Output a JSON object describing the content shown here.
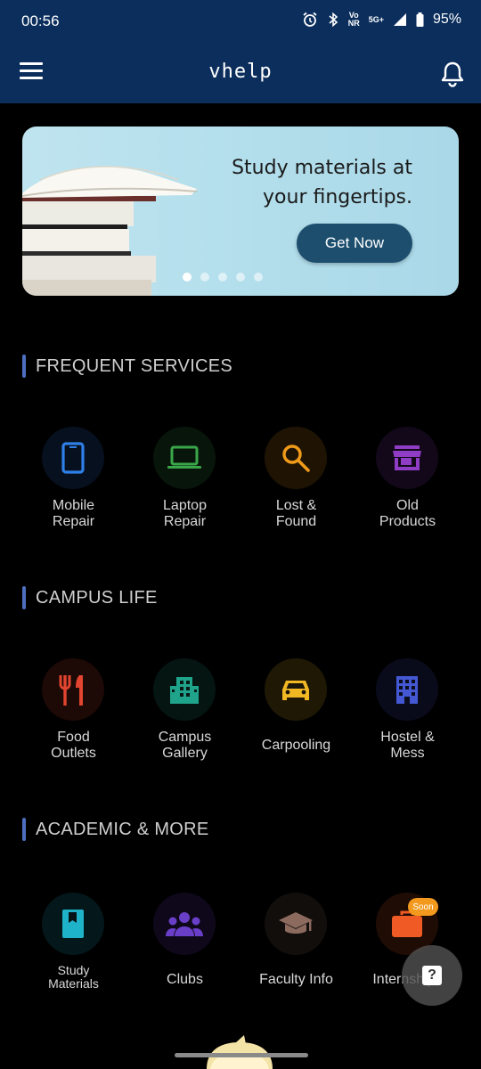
{
  "status_bar": {
    "time": "00:56",
    "network_top": "Vo",
    "network_bottom": "NR",
    "generation": "5G+",
    "battery": "95%"
  },
  "app_bar": {
    "title": "vhelp",
    "menu_icon": "hamburger-menu-icon",
    "notification_icon": "bell-icon"
  },
  "banner": {
    "text_line1": "Study materials at",
    "text_line2": "your fingertips.",
    "button_label": "Get Now",
    "slide_count": 5,
    "active_slide": 1
  },
  "sections": {
    "frequent": {
      "title": "FREQUENT SERVICES",
      "items": [
        {
          "line1": "Mobile",
          "line2": "Repair",
          "icon": "smartphone-icon",
          "color": "#2f7fe8"
        },
        {
          "line1": "Laptop",
          "line2": "Repair",
          "icon": "laptop-icon",
          "color": "#3aa64a"
        },
        {
          "line1": "Lost &",
          "line2": "Found",
          "icon": "search-icon",
          "color": "#f09a1a"
        },
        {
          "line1": "Old",
          "line2": "Products",
          "icon": "store-icon",
          "color": "#8e3dc4"
        }
      ]
    },
    "campus": {
      "title": "CAMPUS LIFE",
      "items": [
        {
          "line1": "Food",
          "line2": "Outlets",
          "icon": "restaurant-icon",
          "color": "#e2452f"
        },
        {
          "line1": "Campus",
          "line2": "Gallery",
          "icon": "building-icon",
          "color": "#1fa38a"
        },
        {
          "line1": "Carpooling",
          "line2": "",
          "icon": "car-icon",
          "color": "#f2b824"
        },
        {
          "line1": "Hostel &",
          "line2": "Mess",
          "icon": "apartment-icon",
          "color": "#4358d2"
        }
      ]
    },
    "academic": {
      "title": "ACADEMIC & MORE",
      "items": [
        {
          "line1": "Study",
          "line2": "Materials",
          "icon": "book-icon",
          "color": "#1fb3c9"
        },
        {
          "line1": "Clubs",
          "line2": "",
          "icon": "group-icon",
          "color": "#6a3fc8"
        },
        {
          "line1": "Faculty Info",
          "line2": "",
          "icon": "graduation-cap-icon",
          "color": "#8c6a5e"
        },
        {
          "line1": "Internships",
          "line2": "",
          "icon": "briefcase-icon",
          "color": "#f05a24",
          "badge": "Soon"
        }
      ]
    }
  },
  "help_fab": {
    "icon": "help-icon",
    "label": "?"
  },
  "colors": {
    "app_bar": "#0b2e5c",
    "section_accent": "#4c6fc0",
    "background": "#000000"
  }
}
